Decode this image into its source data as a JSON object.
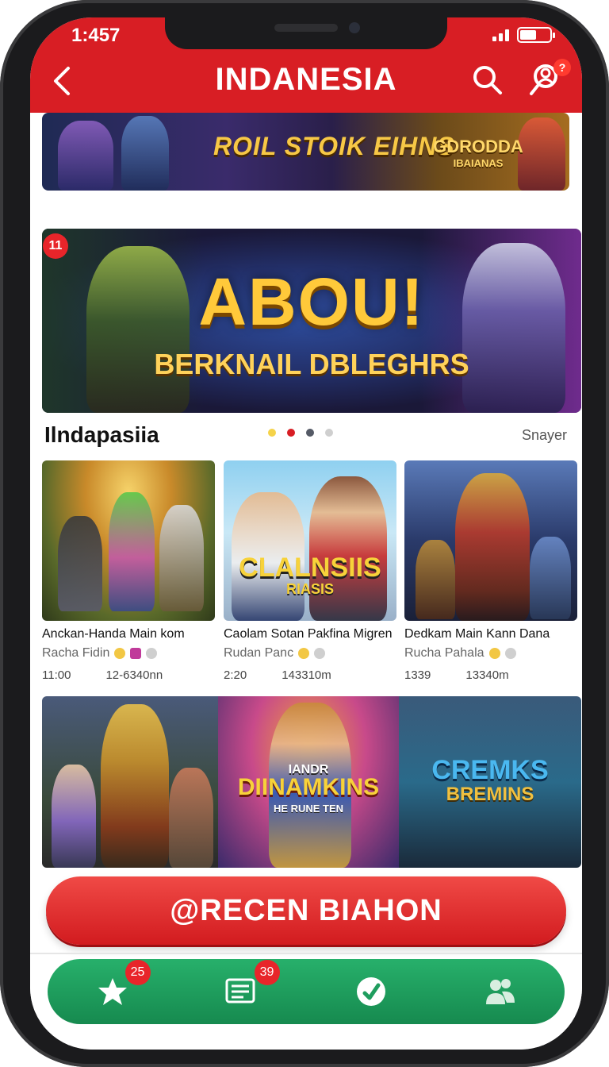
{
  "status_bar": {
    "time": "1:457"
  },
  "header": {
    "title": "INDANESIA",
    "back_icon": "chevron-left-icon",
    "search_icon": "search-icon",
    "user_icon": "user-search-icon",
    "user_badge": "?"
  },
  "banners": {
    "top": {
      "text": "ROIL STOIK EIHNS",
      "side_title": "GDRODDA",
      "side_sub": "IBAIANAS"
    },
    "main": {
      "badge": "11",
      "title": "ABOU!",
      "subtitle": "BERKNAIL DBLEGHRS"
    }
  },
  "section": {
    "title": "Ilndapasiia",
    "see_more": "Snayer",
    "dots": [
      "#f5d34a",
      "#d81e24",
      "#555a66",
      "#cfcfcf"
    ]
  },
  "cards": [
    {
      "title": "Anckan-Handa Main kom",
      "sub": "Racha Fidin",
      "time": "11:00",
      "stat": "12-6340nn"
    },
    {
      "title": "Caolam Sotan Pakfina Migren",
      "sub": "Rudan Panc",
      "time": "2:20",
      "art_text": "CLALNSIIS",
      "art_sub": "RIASIS",
      "stat": "143310m"
    },
    {
      "title": "Dedkam Main Kann Dana",
      "sub": "Rucha Pahala",
      "time": "1339",
      "stat": "13340m"
    }
  ],
  "tiles": [
    {
      "art_text": ""
    },
    {
      "art_top": "IANDR",
      "art_text": "DIINAMKINS",
      "art_sub": "HE RUNE TEN"
    },
    {
      "art_text": "CREMKS",
      "art_sub": "BREMINS"
    }
  ],
  "cta": {
    "label": "@RECEN BIAHON"
  },
  "bottom_nav": [
    {
      "icon": "star-icon",
      "badge": "25"
    },
    {
      "icon": "news-list-icon",
      "badge": "39"
    },
    {
      "icon": "refresh-sync-icon",
      "badge": ""
    },
    {
      "icon": "friends-icon",
      "badge": ""
    }
  ],
  "colors": {
    "header": "#d81e24",
    "cta": "#d21b1f",
    "nav": "#1f9d5e"
  }
}
